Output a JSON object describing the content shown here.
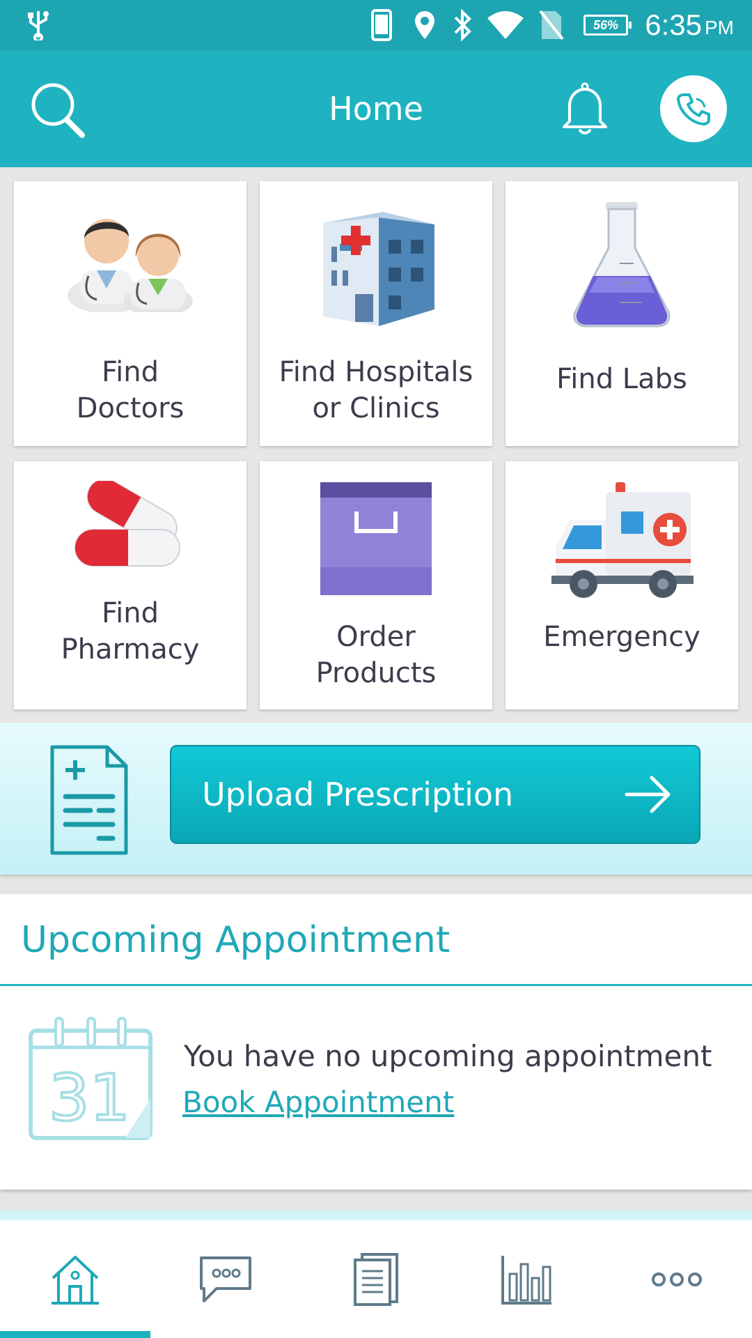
{
  "status_bar": {
    "battery": "56%",
    "time": "6:35",
    "ampm": "PM",
    "icons": [
      "usb-icon",
      "phone-icon",
      "location-icon",
      "bluetooth-icon",
      "wifi-icon",
      "no-sim-icon",
      "battery-icon"
    ]
  },
  "header": {
    "title": "Home",
    "icons": [
      "search-icon",
      "bell-icon",
      "phone-call-icon"
    ]
  },
  "tiles": [
    {
      "label": "Find\nDoctors",
      "icon": "doctors-icon"
    },
    {
      "label": "Find Hospitals\nor Clinics",
      "icon": "hospital-icon"
    },
    {
      "label": "Find Labs",
      "icon": "lab-flask-icon"
    },
    {
      "label": "Find\nPharmacy",
      "icon": "pill-capsule-icon"
    },
    {
      "label": "Order\nProducts",
      "icon": "shopping-bag-icon"
    },
    {
      "label": "Emergency",
      "icon": "ambulance-icon"
    }
  ],
  "upload": {
    "button_label": "Upload Prescription",
    "icon": "prescription-icon"
  },
  "appointment": {
    "title": "Upcoming Appointment",
    "message": "You have no upcoming appointment",
    "link": "Book Appointment",
    "icon": "calendar-icon"
  },
  "bottom_nav": {
    "items": [
      {
        "name": "home",
        "icon": "home-icon",
        "active": true
      },
      {
        "name": "messages",
        "icon": "chat-icon",
        "active": false
      },
      {
        "name": "records",
        "icon": "document-icon",
        "active": false
      },
      {
        "name": "stats",
        "icon": "bar-chart-icon",
        "active": false
      },
      {
        "name": "more",
        "icon": "more-icon",
        "active": false
      }
    ]
  },
  "colors": {
    "status_bar": "#1ea5b2",
    "app_bar": "#1fb3c1",
    "accent": "#1fa8b7",
    "nav_inactive": "#5f7a8a"
  }
}
